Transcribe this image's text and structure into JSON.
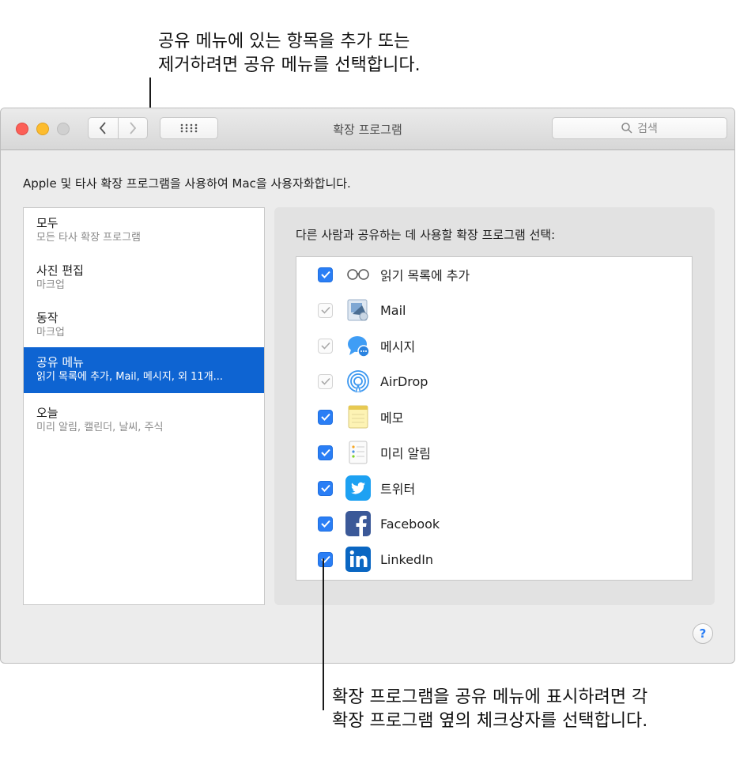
{
  "callouts": {
    "top": [
      "공유 메뉴에 있는 항목을 추가 또는",
      "제거하려면 공유 메뉴를 선택합니다."
    ],
    "bottom": [
      "확장 프로그램을 공유 메뉴에 표시하려면 각",
      "확장 프로그램 옆의 체크상자를 선택합니다."
    ]
  },
  "window": {
    "title": "확장 프로그램",
    "search_placeholder": "검색",
    "description": "Apple 및 타사 확장 프로그램을 사용하여 Mac을 사용자화합니다."
  },
  "sidebar": {
    "items": [
      {
        "title": "모두",
        "subtitle": "모든 타사 확장 프로그램",
        "selected": false
      },
      {
        "title": "사진 편집",
        "subtitle": "마크업",
        "selected": false
      },
      {
        "title": "동작",
        "subtitle": "마크업",
        "selected": false
      },
      {
        "title": "공유 메뉴",
        "subtitle": "읽기 목록에 추가, Mail, 메시지, 외 11개...",
        "selected": true
      },
      {
        "title": "오늘",
        "subtitle": "미리 알림, 캘린더, 날씨, 주식",
        "selected": false
      }
    ]
  },
  "pane": {
    "title": "다른 사람과 공유하는 데 사용할 확장 프로그램 선택:",
    "extensions": [
      {
        "label": "읽기 목록에 추가",
        "checked": true,
        "enabled": true,
        "icon": "reading-list-icon"
      },
      {
        "label": "Mail",
        "checked": true,
        "enabled": false,
        "icon": "mail-icon"
      },
      {
        "label": "메시지",
        "checked": true,
        "enabled": false,
        "icon": "messages-icon"
      },
      {
        "label": "AirDrop",
        "checked": true,
        "enabled": false,
        "icon": "airdrop-icon"
      },
      {
        "label": "메모",
        "checked": true,
        "enabled": true,
        "icon": "notes-icon"
      },
      {
        "label": "미리 알림",
        "checked": true,
        "enabled": true,
        "icon": "reminders-icon"
      },
      {
        "label": "트위터",
        "checked": true,
        "enabled": true,
        "icon": "twitter-icon"
      },
      {
        "label": "Facebook",
        "checked": true,
        "enabled": true,
        "icon": "facebook-icon"
      },
      {
        "label": "LinkedIn",
        "checked": true,
        "enabled": true,
        "icon": "linkedin-icon"
      }
    ]
  },
  "help_label": "?"
}
